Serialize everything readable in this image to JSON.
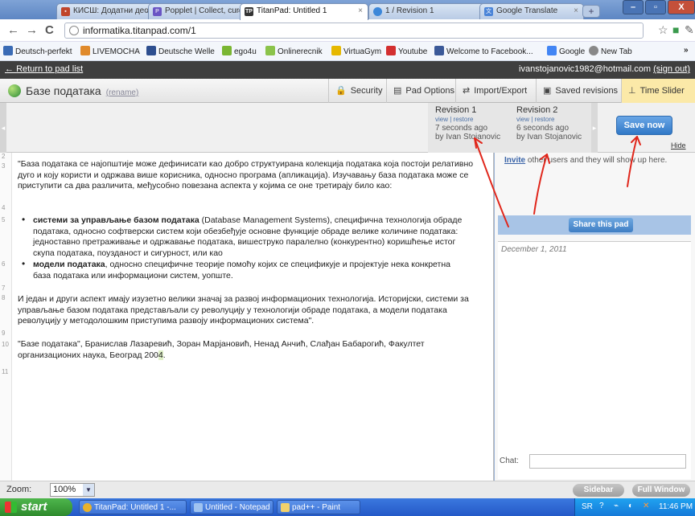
{
  "tabs": [
    {
      "label": "КИСШ: Додатни део: уп",
      "icon": "blog-icon",
      "color": "#c0452a",
      "active": false
    },
    {
      "label": "Popplet | Collect, curate",
      "icon": "popplet-icon",
      "color": "#6a55c4",
      "active": false
    },
    {
      "label": "TitanPad: Untitled 1",
      "icon": "titanpad-icon",
      "color": "#333333",
      "active": true
    },
    {
      "label": "1 / Revision 1",
      "icon": "loading-icon",
      "color": "#3c87d9",
      "active": false
    },
    {
      "label": "Google Translate",
      "icon": "translate-icon",
      "color": "#4a84d8",
      "active": false
    }
  ],
  "address": {
    "url": "informatika.titanpad.com/1"
  },
  "bookmarks": [
    {
      "label": "Deutsch-perfekt",
      "color": "#3a6bb5"
    },
    {
      "label": "LIVEMOCHA",
      "color": "#e08a2b"
    },
    {
      "label": "Deutsche Welle",
      "color": "#2d4e8f"
    },
    {
      "label": "ego4u",
      "color": "#7ab632"
    },
    {
      "label": "Onlinerecnik",
      "color": "#8bc34a"
    },
    {
      "label": "VirtuaGym",
      "color": "#e6b800"
    },
    {
      "label": "Youtube",
      "color": "#d32f2f"
    },
    {
      "label": "Welcome to Facebook...",
      "color": "#3b5998"
    },
    {
      "label": "Google",
      "color": "#4285f4"
    },
    {
      "label": "New Tab",
      "color": "#888888"
    }
  ],
  "pad": {
    "return_link": "Return to pad list",
    "user_email": "ivanstojanovic1982@hotmail.com",
    "sign_out": "(sign out)",
    "title": "Базе података",
    "rename": "(rename)",
    "buttons": {
      "security": "Security",
      "options": "Pad Options",
      "import_export": "Import/Export",
      "saved_revisions": "Saved revisions",
      "time_slider": "Time Slider"
    }
  },
  "revisions": [
    {
      "title": "Revision 1",
      "links": "view | restore",
      "ago": "7 seconds ago",
      "by": "by Ivan Stojanovic"
    },
    {
      "title": "Revision 2",
      "links": "view | restore",
      "ago": "6 seconds ago",
      "by": "by Ivan Stojanovic"
    }
  ],
  "save_now": "Save now",
  "hide": "Hide",
  "editor": {
    "line_numbers": [
      "2",
      "3",
      "4",
      "5",
      "6",
      "7",
      "8",
      "9",
      "10",
      "11"
    ],
    "p1": "\"База података се најопштије може дефинисати као добро структуирана колекција података која постоји релативно дуго и коју користи и одржава више корисника, односно програма (апликација). Изучавању база података може се приступити са два различита, међусобно повезана аспекта у којима се оне третирају било као:",
    "b1_bold": "системи за управљање базом података",
    "b1_rest": " (Database Management Systems), специфична технологија обраде података, односно софтверски систем који обезбеђује основне функције обраде велике количине података: једноставно претраживање и одржавање података, вишеструко паралелно (конкурентно) коришћење истог скупа података, поузданост и сигурност, или као",
    "b2_bold": "модели података",
    "b2_rest": ", односно специфичне теорије помоћу којих се спецификује и пројектује нека конкретна база података или информациони систем, уопште.",
    "p2": "И један и други аспект имају изузетно велики значај за развој информационих технологија. Историјски, системи за управљање базом података представљали су револуцију у технологији обраде података, а модели података револуцију у методолошким приступима развоју информационих система\".",
    "citation_main": "\"Базе података\", Бранислав Лазаревић, Зоран Марјановић, Ненад Анчић, Слађан Бабарогић, Факултет организационих наука, Београд 200",
    "citation_last": "4",
    "citation_end": "."
  },
  "sidebar": {
    "invite_link": "Invite",
    "invite_rest": " other users and they will show up here.",
    "share": "Share this pad",
    "chat_date": "December 1, 2011",
    "chat_label": "Chat:"
  },
  "zoom": {
    "label": "Zoom:",
    "value": "100%"
  },
  "bottom_buttons": {
    "sidebar": "Sidebar",
    "full_window": "Full Window"
  },
  "taskbar": {
    "start": "start",
    "tasks": [
      {
        "label": "TitanPad: Untitled 1 -...",
        "icon": "chrome-icon",
        "color": "#e8b22c"
      },
      {
        "label": "Untitled - Notepad",
        "icon": "notepad-icon",
        "color": "#9fc3f0"
      },
      {
        "label": "pad++ - Paint",
        "icon": "paint-icon",
        "color": "#f2d16b"
      }
    ],
    "lang": "SR",
    "time": "11:46 PM"
  },
  "accent_colors": {
    "arrows": "#e0261b",
    "titlebar": "#5d86c3",
    "time_slider": "#fbe9a8",
    "save": "#3179c7"
  }
}
